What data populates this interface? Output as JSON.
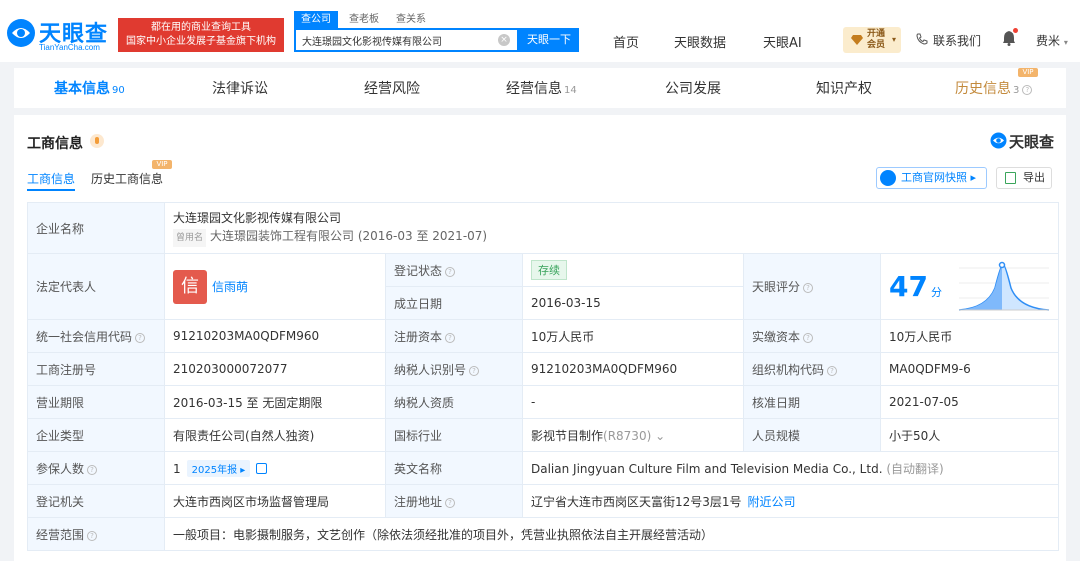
{
  "header": {
    "logo_text": "天眼查",
    "logo_sub": "TianYanCha.com",
    "slogan_line1": "都在用的商业查询工具",
    "slogan_line2": "国家中小企业发展子基金旗下机构",
    "search_tabs": [
      "查公司",
      "查老板",
      "查关系"
    ],
    "search_value": "大连璟园文化影视传媒有限公司",
    "search_button": "天眼一下",
    "nav": [
      "首页",
      "天眼数据",
      "天眼AI"
    ],
    "vip_line1": "开通",
    "vip_line2": "会员",
    "contact": "联系我们",
    "user": "费米"
  },
  "tabs": [
    {
      "label": "基本信息",
      "count": "90"
    },
    {
      "label": "法律诉讼",
      "count": ""
    },
    {
      "label": "经营风险",
      "count": ""
    },
    {
      "label": "经营信息",
      "count": "14"
    },
    {
      "label": "公司发展",
      "count": ""
    },
    {
      "label": "知识产权",
      "count": ""
    },
    {
      "label": "历史信息",
      "count": "3"
    }
  ],
  "vip_label": "VIP",
  "card": {
    "title": "工商信息",
    "brand": "天眼查",
    "subtabs": [
      "工商信息",
      "历史工商信息"
    ],
    "snapshot_button": "工商官网快照",
    "export_button": "导出"
  },
  "info": {
    "company_name_label": "企业名称",
    "company_name": "大连璟园文化影视传媒有限公司",
    "old_name_label": "曾用名",
    "old_name": "大连璟园装饰工程有限公司 (2016-03 至 2021-07)",
    "legal_rep_label": "法定代表人",
    "legal_rep_avatar": "信",
    "legal_rep_name": "信雨萌",
    "reg_status_label": "登记状态",
    "reg_status": "存续",
    "found_date_label": "成立日期",
    "found_date": "2016-03-15",
    "score_label": "天眼评分",
    "score": "47",
    "score_unit": "分",
    "credit_code_label": "统一社会信用代码",
    "credit_code": "91210203MA0QDFM960",
    "reg_capital_label": "注册资本",
    "reg_capital": "10万人民币",
    "paid_capital_label": "实缴资本",
    "paid_capital": "10万人民币",
    "reg_no_label": "工商注册号",
    "reg_no": "210203000072077",
    "taxpayer_id_label": "纳税人识别号",
    "taxpayer_id": "91210203MA0QDFM960",
    "org_code_label": "组织机构代码",
    "org_code": "MA0QDFM9-6",
    "term_label": "营业期限",
    "term": "2016-03-15 至 无固定期限",
    "taxpayer_qual_label": "纳税人资质",
    "taxpayer_qual": "-",
    "approve_date_label": "核准日期",
    "approve_date": "2021-07-05",
    "company_type_label": "企业类型",
    "company_type": "有限责任公司(自然人独资)",
    "industry_label": "国标行业",
    "industry": "影视节目制作",
    "industry_code": "(R8730)",
    "staff_size_label": "人员规模",
    "staff_size": "小于50人",
    "insured_label": "参保人数",
    "insured": "1",
    "insured_report": "2025年报",
    "english_name_label": "英文名称",
    "english_name": "Dalian Jingyuan Culture Film and Television Media Co., Ltd.",
    "english_note": "(自动翻译)",
    "authority_label": "登记机关",
    "authority": "大连市西岗区市场监督管理局",
    "address_label": "注册地址",
    "address": "辽宁省大连市西岗区天富街12号3层1号",
    "nearby": "附近公司",
    "scope_label": "经营范围",
    "scope": "一般项目：电影摄制服务，文艺创作（除依法须经批准的项目外，凭营业执照依法自主开展经营活动）"
  },
  "colors": {
    "accent": "#0084ff",
    "brand_red": "#e03a30",
    "status_green": "#38a35b",
    "vip_gold": "#c38a3c"
  }
}
